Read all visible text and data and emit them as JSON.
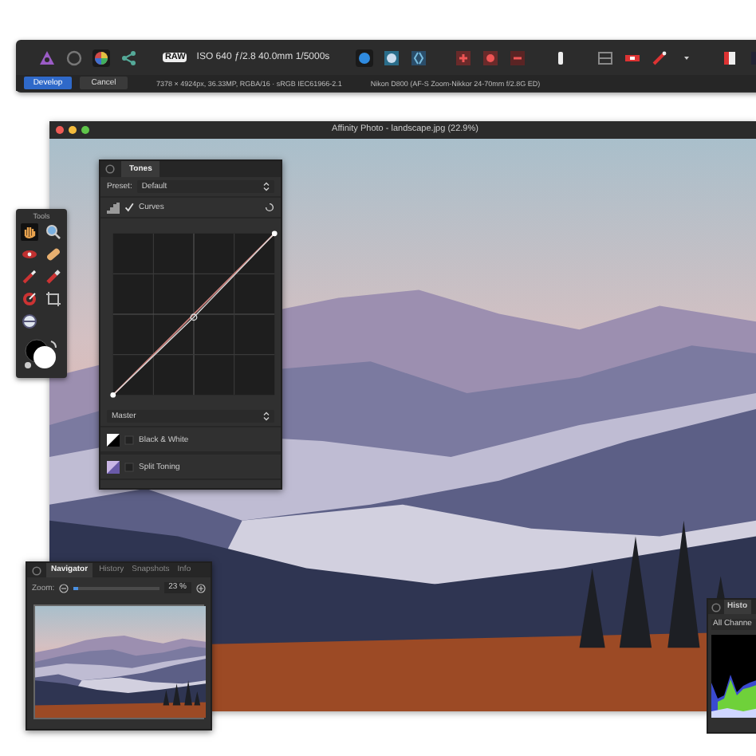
{
  "toolbar": {
    "raw_badge": "RAW",
    "exif": "ISO 640 ƒ/2.8 40.0mm 1/5000s",
    "buttons": [
      {
        "label": "Develop",
        "kind": "primary"
      },
      {
        "label": "Cancel",
        "kind": "secondary"
      }
    ],
    "image_info": "7378 × 4924px, 36.33MP, RGBA/16 · sRGB IEC61966-2.1",
    "lens_info": "Nikon D800 (AF-S Zoom-Nikkor 24-70mm f/2.8G ED)"
  },
  "document": {
    "title": "Affinity Photo - landscape.jpg (22.9%)"
  },
  "tones_panel": {
    "tab": "Tones",
    "preset_label": "Preset:",
    "preset": "Default",
    "curves": {
      "label": "Curves",
      "checked": true
    },
    "channel": "Master",
    "adjustments": [
      {
        "label": "Black & White",
        "checked": false,
        "kind": "black_white"
      },
      {
        "label": "Split Toning",
        "checked": false,
        "kind": "split_toning"
      }
    ]
  },
  "tools_panel": {
    "title": "Tools"
  },
  "navigator": {
    "tabs": [
      {
        "label": "Navigator",
        "selected": true
      },
      {
        "label": "History",
        "selected": false
      },
      {
        "label": "Snapshots",
        "selected": false
      },
      {
        "label": "Info",
        "selected": false
      }
    ],
    "zoom_label": "Zoom:",
    "zoom": {
      "level": 0.06
    },
    "zoom_value": "23 %"
  },
  "histogram": {
    "tab": "Histo",
    "channel": "All Channe"
  }
}
